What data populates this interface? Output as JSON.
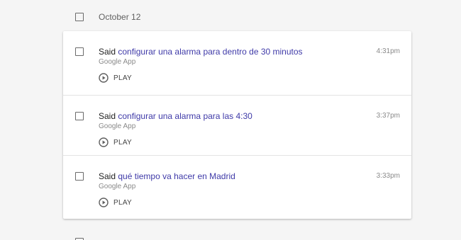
{
  "day": {
    "title": "October 12"
  },
  "entries": [
    {
      "prefix": "Said",
      "query": "configurar una alarma para dentro de 30 minutos",
      "source": "Google App",
      "time": "4:31pm",
      "play_label": "PLAY"
    },
    {
      "prefix": "Said",
      "query": "configurar una alarma para las 4:30",
      "source": "Google App",
      "time": "3:37pm",
      "play_label": "PLAY"
    },
    {
      "prefix": "Said",
      "query": "qué tiempo va hacer en Madrid",
      "source": "Google App",
      "time": "3:33pm",
      "play_label": "PLAY"
    }
  ],
  "icons": {
    "checkbox": "checkbox-icon",
    "play": "play-circle-icon"
  },
  "colors": {
    "background": "#f5f5f5",
    "card": "#ffffff",
    "query_link": "#3f3aa8",
    "secondary_text": "#8a8a8a"
  }
}
